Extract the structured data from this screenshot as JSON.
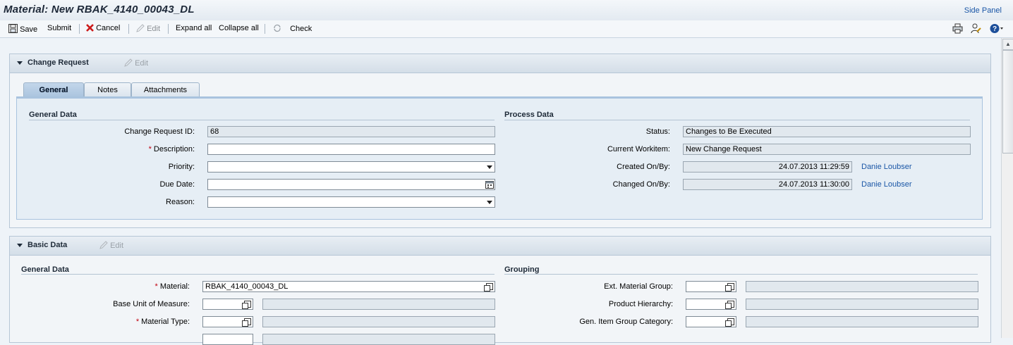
{
  "title": "Material: New RBAK_4140_00043_DL",
  "side_panel": "Side Panel",
  "toolbar": {
    "save": "Save",
    "submit": "Submit",
    "cancel": "Cancel",
    "edit": "Edit",
    "expand_all": "Expand all",
    "collapse_all": "Collapse all",
    "check": "Check"
  },
  "change_request": {
    "title": "Change Request",
    "edit": "Edit",
    "tabs": [
      {
        "label": "General",
        "active": true
      },
      {
        "label": "Notes",
        "active": false
      },
      {
        "label": "Attachments",
        "active": false
      }
    ],
    "general_data": {
      "title": "General Data",
      "change_request_id_label": "Change Request ID:",
      "change_request_id": "68",
      "description_label": "Description:",
      "description": "",
      "priority_label": "Priority:",
      "priority": "",
      "due_date_label": "Due Date:",
      "due_date": "",
      "reason_label": "Reason:",
      "reason": ""
    },
    "process_data": {
      "title": "Process Data",
      "status_label": "Status:",
      "status": "Changes to Be Executed",
      "current_workitem_label": "Current Workitem:",
      "current_workitem": "New Change Request",
      "created_label": "Created On/By:",
      "created_on": "24.07.2013 11:29:59",
      "created_by": "Danie Loubser",
      "changed_label": "Changed On/By:",
      "changed_on": "24.07.2013 11:30:00",
      "changed_by": "Danie Loubser"
    }
  },
  "basic_data": {
    "title": "Basic Data",
    "edit": "Edit",
    "general_data": {
      "title": "General Data",
      "material_label": "Material:",
      "material": "RBAK_4140_00043_DL",
      "base_uom_label": "Base Unit of Measure:",
      "base_uom": "",
      "material_type_label": "Material Type:",
      "material_type": ""
    },
    "grouping": {
      "title": "Grouping",
      "ext_material_group_label": "Ext. Material Group:",
      "product_hierarchy_label": "Product Hierarchy:",
      "gen_item_group_category_label": "Gen. Item Group Category:"
    }
  },
  "colors": {
    "link": "#1a56a6",
    "required": "#c1000f",
    "panel_header": "#d4dee8"
  }
}
